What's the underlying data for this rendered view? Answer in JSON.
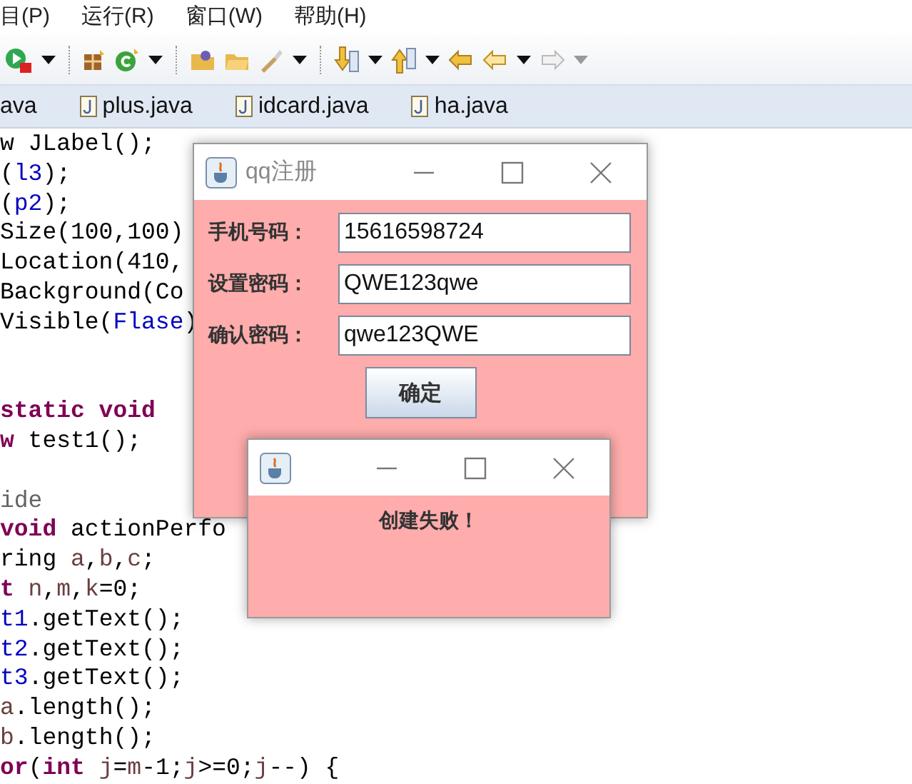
{
  "menu_bar": {
    "items": [
      "目(P)",
      "运行(R)",
      "窗口(W)",
      "帮助(H)"
    ]
  },
  "editor_tabs": [
    {
      "label": "ava",
      "icon": false
    },
    {
      "label": "plus.java",
      "icon": true
    },
    {
      "label": "idcard.java",
      "icon": true
    },
    {
      "label": "ha.java",
      "icon": true
    }
  ],
  "code_lines": [
    {
      "segments": [
        {
          "text": "w JLabel();",
          "kind": "plain"
        }
      ]
    },
    {
      "segments": [
        {
          "text": "(",
          "kind": "plain"
        },
        {
          "text": "l3",
          "kind": "field"
        },
        {
          "text": ");",
          "kind": "plain"
        }
      ]
    },
    {
      "segments": [
        {
          "text": "(",
          "kind": "plain"
        },
        {
          "text": "p2",
          "kind": "field"
        },
        {
          "text": ");",
          "kind": "plain"
        }
      ]
    },
    {
      "segments": [
        {
          "text": "Size(100,100)",
          "kind": "plain"
        }
      ]
    },
    {
      "segments": [
        {
          "text": "Location(410,",
          "kind": "plain"
        }
      ]
    },
    {
      "segments": [
        {
          "text": "Background(Co",
          "kind": "plain"
        }
      ]
    },
    {
      "segments": [
        {
          "text": "Visible(",
          "kind": "plain"
        },
        {
          "text": "Flase",
          "kind": "field"
        },
        {
          "text": ")",
          "kind": "plain"
        }
      ]
    },
    {
      "kind": "blank"
    },
    {
      "kind": "blank"
    },
    {
      "segments": [
        {
          "text": "static void",
          "kind": "keyword"
        }
      ]
    },
    {
      "segments": [
        {
          "text": "w",
          "kind": "keyword"
        },
        {
          "text": " test1();",
          "kind": "plain"
        }
      ]
    },
    {
      "kind": "blank"
    },
    {
      "segments": [
        {
          "text": "ide",
          "kind": "annotation"
        }
      ]
    },
    {
      "segments": [
        {
          "text": "void",
          "kind": "keyword"
        },
        {
          "text": " actionPerfo",
          "kind": "plain"
        }
      ]
    },
    {
      "segments": [
        {
          "text": "ring ",
          "kind": "plain"
        },
        {
          "text": "a",
          "kind": "local"
        },
        {
          "text": ",",
          "kind": "plain"
        },
        {
          "text": "b",
          "kind": "local"
        },
        {
          "text": ",",
          "kind": "plain"
        },
        {
          "text": "c",
          "kind": "local"
        },
        {
          "text": ";",
          "kind": "plain"
        }
      ]
    },
    {
      "segments": [
        {
          "text": "t",
          "kind": "keyword"
        },
        {
          "text": " n",
          "kind": "local"
        },
        {
          "text": ",",
          "kind": "plain"
        },
        {
          "text": "m",
          "kind": "local"
        },
        {
          "text": ",",
          "kind": "plain"
        },
        {
          "text": "k",
          "kind": "local"
        },
        {
          "text": "=0;",
          "kind": "plain"
        }
      ]
    },
    {
      "segments": [
        {
          "text": "t1",
          "kind": "field"
        },
        {
          "text": ".getText();",
          "kind": "plain"
        }
      ]
    },
    {
      "segments": [
        {
          "text": "t2",
          "kind": "field"
        },
        {
          "text": ".getText();",
          "kind": "plain"
        }
      ]
    },
    {
      "segments": [
        {
          "text": "t3",
          "kind": "field"
        },
        {
          "text": ".getText();",
          "kind": "plain"
        }
      ]
    },
    {
      "segments": [
        {
          "text": "a",
          "kind": "local"
        },
        {
          "text": ".length();",
          "kind": "plain"
        }
      ]
    },
    {
      "segments": [
        {
          "text": "b",
          "kind": "local"
        },
        {
          "text": ".length();",
          "kind": "plain"
        }
      ]
    },
    {
      "segments": [
        {
          "text": "or",
          "kind": "keyword"
        },
        {
          "text": "(",
          "kind": "plain"
        },
        {
          "text": "int",
          "kind": "keyword"
        },
        {
          "text": " j",
          "kind": "local"
        },
        {
          "text": "=",
          "kind": "plain"
        },
        {
          "text": "m",
          "kind": "local"
        },
        {
          "text": "-1;",
          "kind": "plain"
        },
        {
          "text": "j",
          "kind": "local"
        },
        {
          "text": ">=0;",
          "kind": "plain"
        },
        {
          "text": "j",
          "kind": "local"
        },
        {
          "text": "--) {",
          "kind": "plain"
        }
      ]
    }
  ],
  "register_dialog": {
    "title": "qq注册",
    "fields": [
      {
        "label": "手机号码：",
        "value": "15616598724"
      },
      {
        "label": "设置密码：",
        "value": "QWE123qwe"
      },
      {
        "label": "确认密码：",
        "value": "qwe123QWE"
      }
    ],
    "button": "确定"
  },
  "message_dialog": {
    "message": "创建失败！"
  }
}
